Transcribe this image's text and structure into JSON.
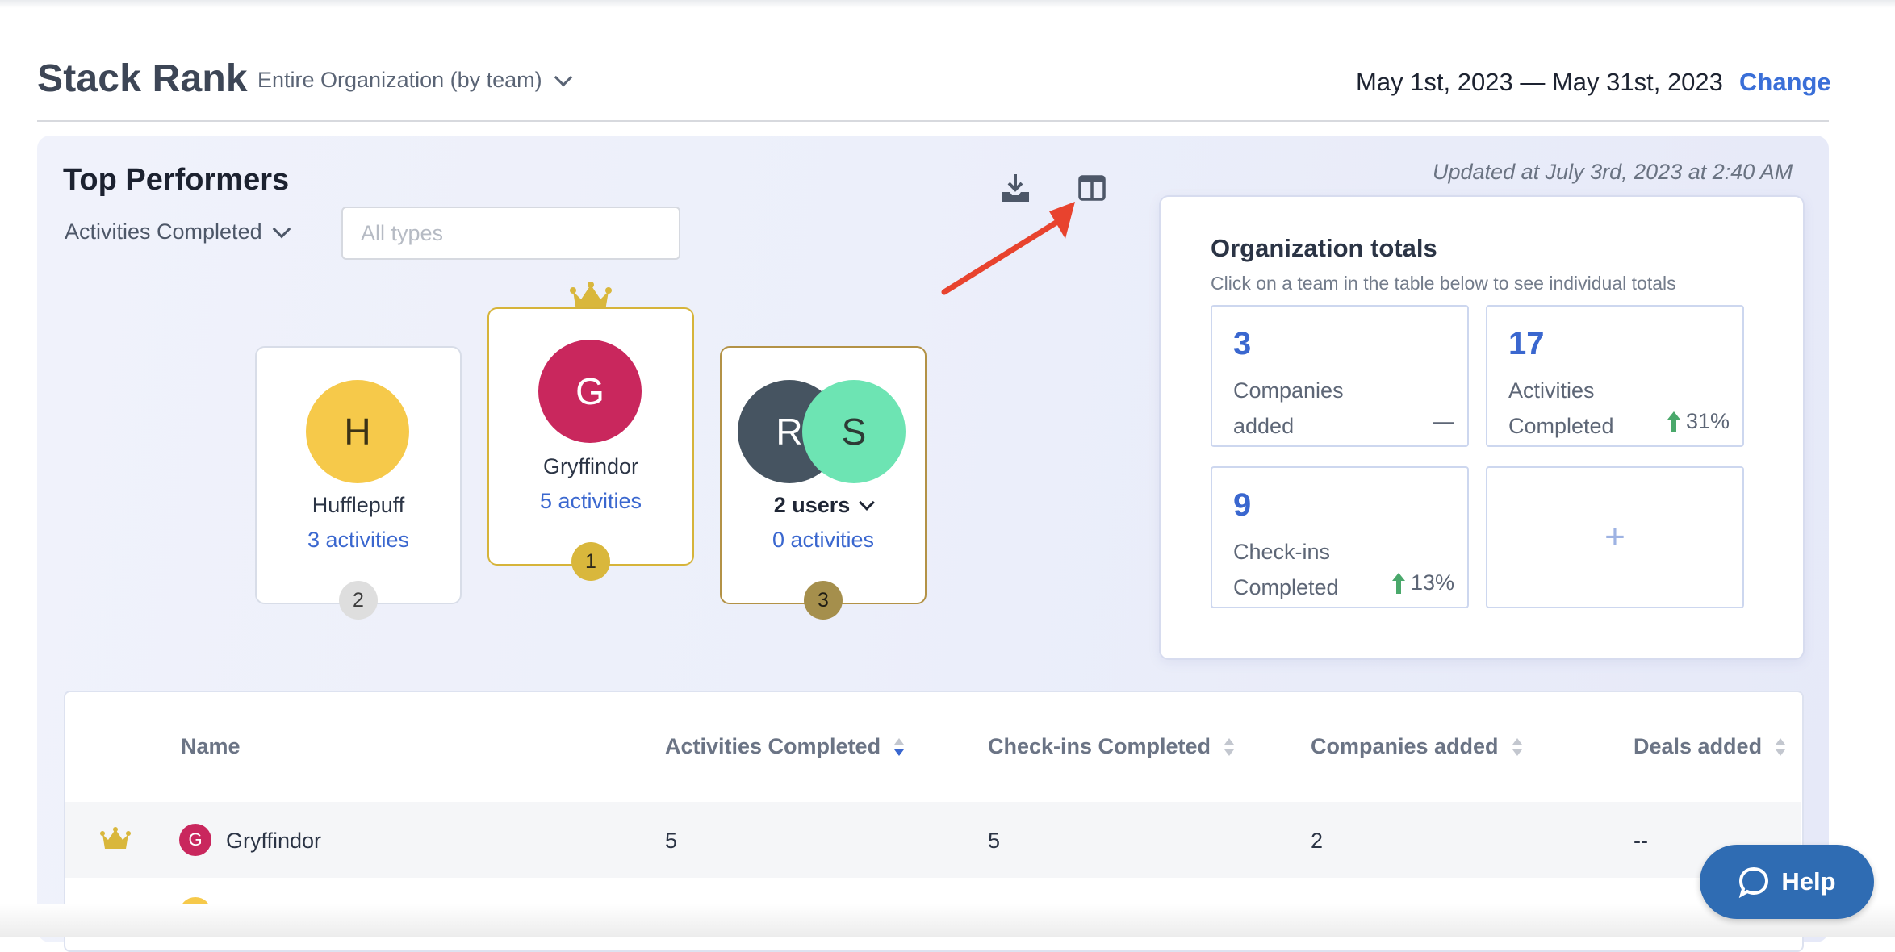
{
  "header": {
    "title": "Stack Rank",
    "scope": "Entire Organization (by team)",
    "date_range": "May 1st, 2023 — May 31st, 2023",
    "change_label": "Change"
  },
  "top_performers": {
    "title": "Top Performers",
    "metric": "Activities Completed",
    "type_placeholder": "All types",
    "updated": "Updated at July 3rd, 2023 at 2:40 AM",
    "podium": [
      {
        "rank": "1",
        "initial": "G",
        "name": "Gryffindor",
        "activities": "5 activities"
      },
      {
        "rank": "2",
        "initial": "H",
        "name": "Hufflepuff",
        "activities": "3 activities"
      },
      {
        "rank": "3",
        "initial_a": "R",
        "initial_b": "S",
        "name": "2 users",
        "activities": "0 activities"
      }
    ]
  },
  "org_totals": {
    "title": "Organization totals",
    "subtitle": "Click on a team in the table below to see individual totals",
    "stats": [
      {
        "value": "3",
        "label": "Companies added",
        "change": "—"
      },
      {
        "value": "17",
        "label": "Activities Completed",
        "change": "31%"
      },
      {
        "value": "9",
        "label": "Check-ins Completed",
        "change": "13%"
      }
    ],
    "add_symbol": "+"
  },
  "table": {
    "columns": [
      "Name",
      "Activities Completed",
      "Check-ins Completed",
      "Companies added",
      "Deals added"
    ],
    "rows": [
      {
        "initial": "G",
        "name": "Gryffindor",
        "activities": "5",
        "checkins": "5",
        "companies": "2",
        "deals": "--"
      }
    ]
  },
  "help": {
    "label": "Help"
  },
  "colors": {
    "accent": "#3a6fd8",
    "gold": "#d9b73c",
    "up_arrow": "#4aa86b",
    "help_bg": "#2f6cb3",
    "annotation_arrow": "#e8432e"
  }
}
